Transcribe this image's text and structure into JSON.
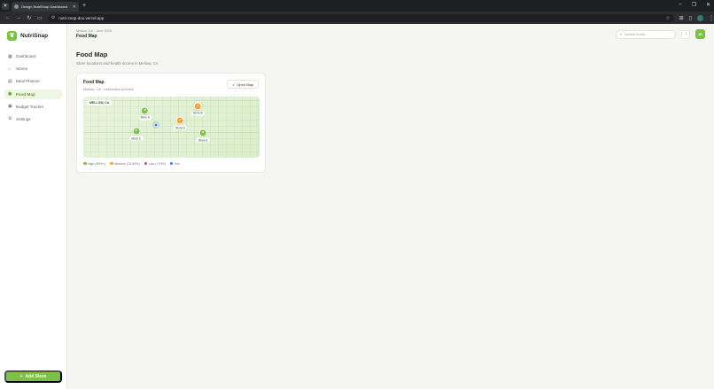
{
  "browser": {
    "tab_title": "Design NutriSnap Dashboard",
    "url": "nutri-snap-doo.vercel.app"
  },
  "brand": {
    "name": "NutriSnap"
  },
  "sidebar": {
    "items": [
      {
        "label": "Dashboard",
        "icon": "grid-icon"
      },
      {
        "label": "Stores",
        "icon": "store-icon"
      },
      {
        "label": "Meal Planner",
        "icon": "calendar-icon"
      },
      {
        "label": "Food Map",
        "icon": "map-pin-icon"
      },
      {
        "label": "Budget Tracker",
        "icon": "wallet-icon"
      },
      {
        "label": "Settings",
        "icon": "gear-icon"
      }
    ],
    "active_index": 3,
    "add_store_label": "Add Store"
  },
  "header": {
    "location": "Mellow, CA · June 2026",
    "title": "Food Map",
    "search_placeholder": "Search foods...",
    "avatar_initials": "JD"
  },
  "page": {
    "title": "Food Map",
    "subtitle": "Store locations and health scores in Mellow, CA"
  },
  "card": {
    "title": "Food Map",
    "subtitle": "Mellow, CA · Interactive preview",
    "open_map_label": "Open Map",
    "map_tag": "MELLOW, CA"
  },
  "map": {
    "stores": [
      {
        "name": "Store A",
        "score_level": "high",
        "color": "#7bc143",
        "xf": 0.35,
        "yf": 0.16
      },
      {
        "name": "Store B",
        "score_level": "medium",
        "color": "#f2a33a",
        "xf": 0.65,
        "yf": 0.09
      },
      {
        "name": "Store C",
        "score_level": "high",
        "color": "#7bc143",
        "xf": 0.3,
        "yf": 0.5
      },
      {
        "name": "Store D",
        "score_level": "medium",
        "color": "#f2a33a",
        "xf": 0.55,
        "yf": 0.33
      },
      {
        "name": "Store E",
        "score_level": "high",
        "color": "#7bc143",
        "xf": 0.68,
        "yf": 0.53
      }
    ],
    "you": {
      "xf": 0.41,
      "yf": 0.47
    }
  },
  "legend": [
    {
      "label": "High (80%+)",
      "color": "#7bc143"
    },
    {
      "label": "Medium (70-84%)",
      "color": "#f2a33a"
    },
    {
      "label": "Low (<70%)",
      "color": "#e5484d"
    },
    {
      "label": "You",
      "color": "#3a7bd5"
    }
  ]
}
